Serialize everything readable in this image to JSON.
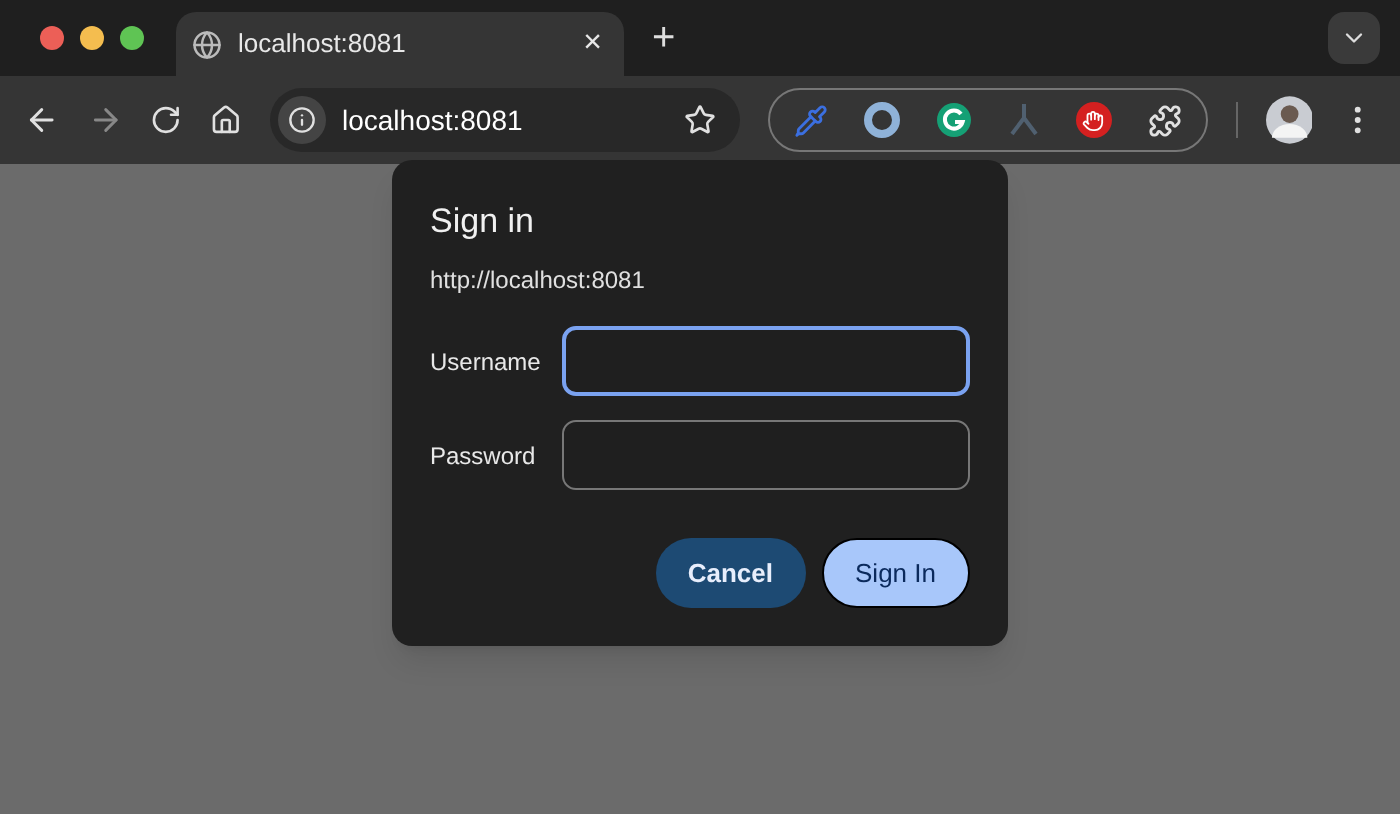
{
  "tab": {
    "title": "localhost:8081",
    "close": "×",
    "new_tab": "+"
  },
  "toolbar": {
    "address": "localhost:8081"
  },
  "dialog": {
    "title": "Sign in",
    "origin": "http://localhost:8081",
    "fields": [
      {
        "label": "Username",
        "focused": true
      },
      {
        "label": "Password",
        "focused": false
      }
    ],
    "buttons": [
      {
        "label": "Cancel",
        "kind": "secondary"
      },
      {
        "label": "Sign In",
        "kind": "primary"
      }
    ]
  }
}
